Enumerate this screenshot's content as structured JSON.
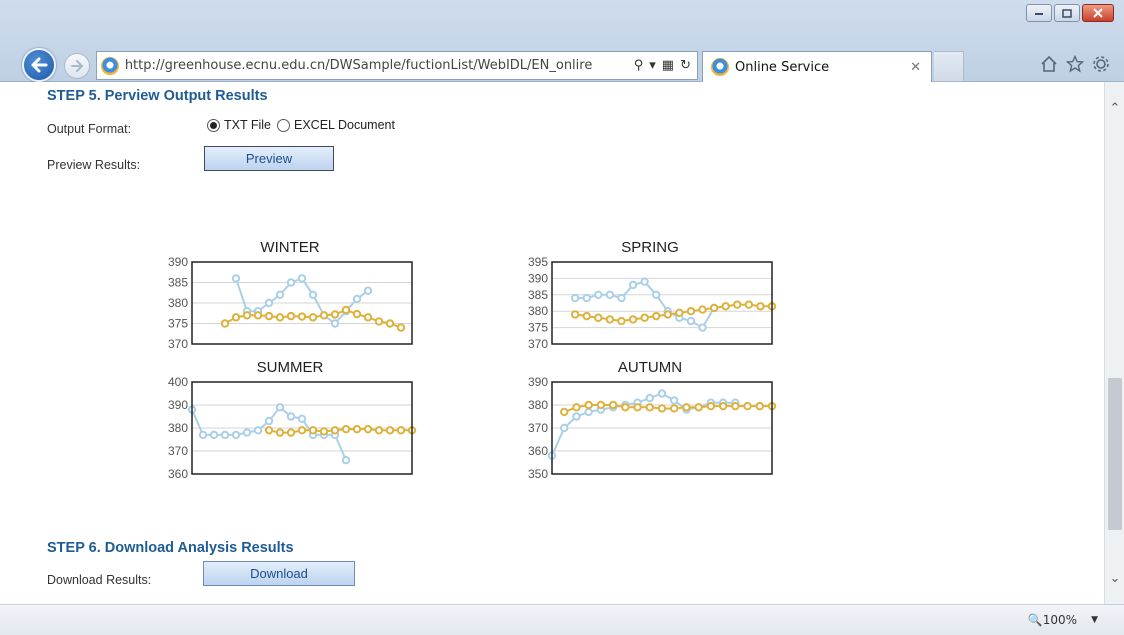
{
  "browser": {
    "url": "http://greenhouse.ecnu.edu.cn/DWSample/fuctionList/WebIDL/EN_onlire",
    "tab_title": "Online Service",
    "zoom": "100%"
  },
  "step5": {
    "title": "STEP 5. Perview Output Results",
    "output_format_label": "Output Format:",
    "format_options": [
      "TXT File",
      "EXCEL Document"
    ],
    "selected_format": "TXT File",
    "preview_label": "Preview Results:",
    "preview_button": "Preview"
  },
  "step6": {
    "title": "STEP 6. Download Analysis Results",
    "download_label": "Download Results:",
    "download_button": "Download"
  },
  "colors": {
    "series_blue": "#aacfe8",
    "series_yellow": "#ddb13c",
    "step_title": "#1f5c95"
  },
  "chart_data": [
    {
      "type": "line",
      "title": "WINTER",
      "ylim": [
        370,
        390
      ],
      "yticks": [
        "390",
        "385",
        "380",
        "375",
        "370"
      ],
      "series": [
        {
          "color": "#aacfe8",
          "values": [
            null,
            null,
            null,
            null,
            386,
            378,
            378,
            380,
            382,
            385,
            386,
            382,
            377,
            375,
            378,
            381,
            383,
            null,
            null,
            null,
            null
          ]
        },
        {
          "color": "#ddb13c",
          "values": [
            null,
            null,
            null,
            375,
            376.5,
            377,
            377,
            376.8,
            376.5,
            376.8,
            376.7,
            376.5,
            377,
            377.2,
            378.3,
            377.3,
            376.5,
            375.5,
            375,
            374,
            null
          ]
        }
      ]
    },
    {
      "type": "line",
      "title": "SPRING",
      "ylim": [
        370,
        395
      ],
      "yticks": [
        "395",
        "390",
        "385",
        "380",
        "375",
        "370"
      ],
      "series": [
        {
          "color": "#aacfe8",
          "values": [
            null,
            null,
            384,
            384,
            385,
            385,
            384,
            388,
            389,
            385,
            380,
            378,
            377,
            375,
            381,
            null,
            null,
            null,
            null,
            null
          ]
        },
        {
          "color": "#ddb13c",
          "values": [
            null,
            null,
            379,
            378.5,
            378,
            377.5,
            377,
            377.5,
            378,
            378.5,
            379,
            379.5,
            380,
            380.5,
            381,
            381.5,
            382,
            382,
            381.5,
            381.5
          ]
        }
      ]
    },
    {
      "type": "line",
      "title": "SUMMER",
      "ylim": [
        360,
        400
      ],
      "yticks": [
        "400",
        "390",
        "380",
        "370",
        "360"
      ],
      "series": [
        {
          "color": "#aacfe8",
          "values": [
            388,
            377,
            377,
            377,
            377,
            378,
            379,
            383,
            389,
            385,
            384,
            377,
            377,
            377,
            366,
            null,
            null,
            null,
            null,
            null,
            null
          ]
        },
        {
          "color": "#ddb13c",
          "values": [
            null,
            null,
            null,
            null,
            null,
            null,
            null,
            379,
            378,
            378,
            379,
            379,
            378.5,
            379,
            379.5,
            379.5,
            379.5,
            379,
            379,
            379,
            379
          ]
        }
      ]
    },
    {
      "type": "line",
      "title": "AUTUMN",
      "ylim": [
        350,
        390
      ],
      "yticks": [
        "390",
        "380",
        "370",
        "360",
        "350"
      ],
      "series": [
        {
          "color": "#aacfe8",
          "values": [
            358,
            370,
            375,
            377,
            378,
            379,
            380,
            381,
            383,
            385,
            382,
            378,
            379,
            381,
            381,
            381,
            null,
            null,
            null
          ]
        },
        {
          "color": "#ddb13c",
          "values": [
            null,
            377,
            379,
            380,
            380,
            380,
            379,
            379,
            379,
            378.5,
            378.5,
            379,
            379,
            379.5,
            379.5,
            379.5,
            379.5,
            379.5,
            379.5
          ]
        }
      ]
    }
  ]
}
